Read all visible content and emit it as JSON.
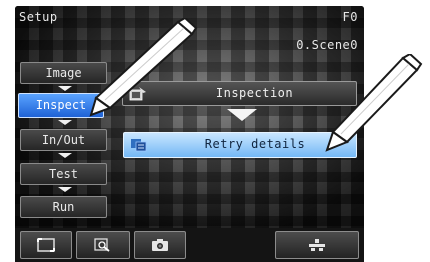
{
  "header": {
    "title": "Setup",
    "scene_code": "F0",
    "scene_name": "0.Scene0"
  },
  "sidebar": {
    "items": [
      {
        "label": "Image"
      },
      {
        "label": "Inspect"
      },
      {
        "label": "In/Out"
      },
      {
        "label": "Test"
      },
      {
        "label": "Run"
      }
    ],
    "active_index": 1
  },
  "menu": {
    "inspection": {
      "label": "Inspection",
      "icon": "inspection-icon"
    },
    "retry": {
      "label": "Retry details",
      "icon": "retry-details-icon"
    }
  },
  "toolbar": {
    "buttons": [
      {
        "icon": "frame-icon"
      },
      {
        "icon": "zoom-icon"
      },
      {
        "icon": "camera-icon"
      },
      {
        "icon": "settings-icon"
      }
    ]
  },
  "colors": {
    "active": "#1e62d6",
    "highlight": "#9ed0ff",
    "background": "#1b1b1b"
  }
}
